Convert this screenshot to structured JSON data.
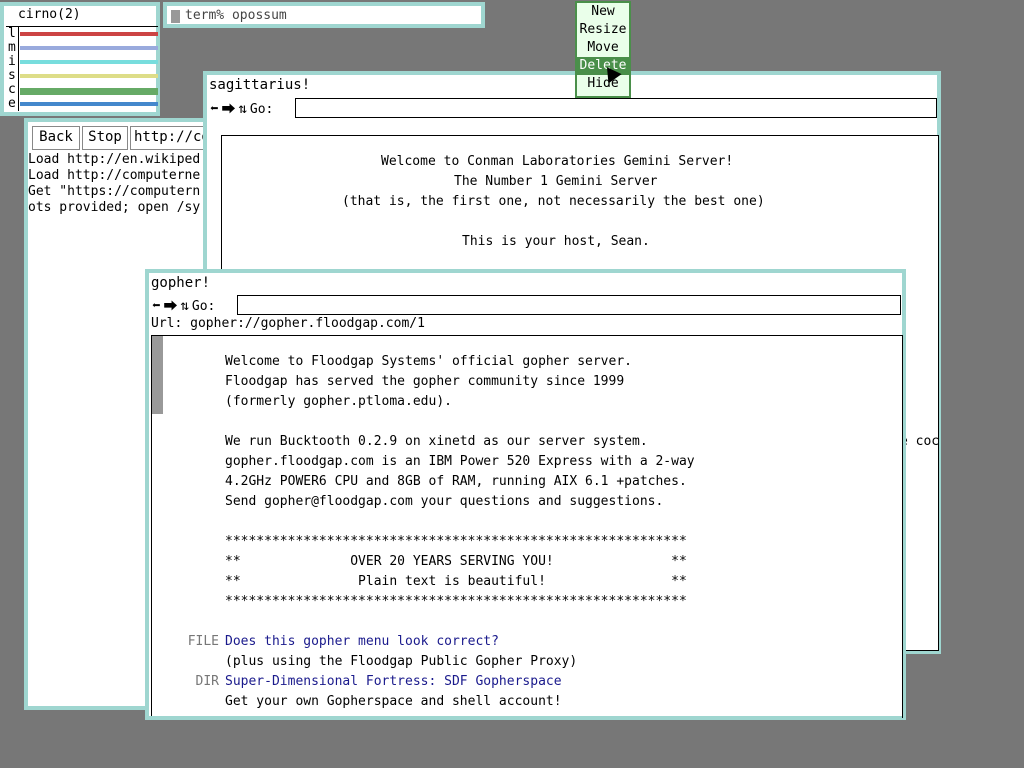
{
  "colors": {
    "desktop": "#777777",
    "window_border": "#9fd6d0",
    "menu_bg": "#eaffea",
    "menu_highlight": "#4a8f4a",
    "link": "#1a1a8c"
  },
  "cirno": {
    "title": "cirno(2)",
    "labels": [
      "l",
      "m",
      "i",
      "s",
      "c",
      "e"
    ]
  },
  "term": {
    "title": "term% opossum"
  },
  "wm_menu": {
    "items": [
      "New",
      "Resize",
      "Move",
      "Delete",
      "Hide"
    ],
    "selected": "Delete"
  },
  "abaco": {
    "back": "Back",
    "stop": "Stop",
    "url": "http://co",
    "log": [
      "Load http://en.wikiped",
      "Load http://computerne",
      "Get \"https://computern",
      "ots provided; open /sy"
    ]
  },
  "sagittarius": {
    "title": "sagittarius!",
    "go_label": "Go:",
    "lines": [
      "Welcome to Conman Laboratories Gemini Server!",
      "The Number 1 Gemini Server",
      "(that is, the first one, not necessarily the best one)",
      "This is your host, Sean."
    ],
    "fragment": "e coc"
  },
  "gopher": {
    "title": "gopher!",
    "go_label": "Go:",
    "url_label": "Url: gopher://gopher.floodgap.com/1",
    "text_lines": [
      "Welcome to Floodgap Systems' official gopher server.",
      "Floodgap has served the gopher community since 1999",
      "(formerly gopher.ptloma.edu).",
      "",
      "We run Bucktooth 0.2.9 on xinetd as our server system.",
      "gopher.floodgap.com is an IBM Power 520 Express with a 2-way",
      "4.2GHz POWER6 CPU and 8GB of RAM, running AIX 6.1 +patches.",
      "Send gopher@floodgap.com your questions and suggestions.",
      "",
      "***********************************************************",
      "**              OVER 20 YEARS SERVING YOU!               **",
      "**               Plain text is beautiful!                **",
      "***********************************************************"
    ],
    "entries": [
      {
        "type": "FILE",
        "text": "Does this gopher menu look correct?",
        "link": true
      },
      {
        "type": "",
        "text": "(plus using the Floodgap Public Gopher Proxy)",
        "link": false
      },
      {
        "type": "DIR",
        "text": "Super-Dimensional Fortress: SDF Gopherspace",
        "link": true
      },
      {
        "type": "",
        "text": "Get your own Gopherspace and shell account!",
        "link": false
      }
    ]
  }
}
